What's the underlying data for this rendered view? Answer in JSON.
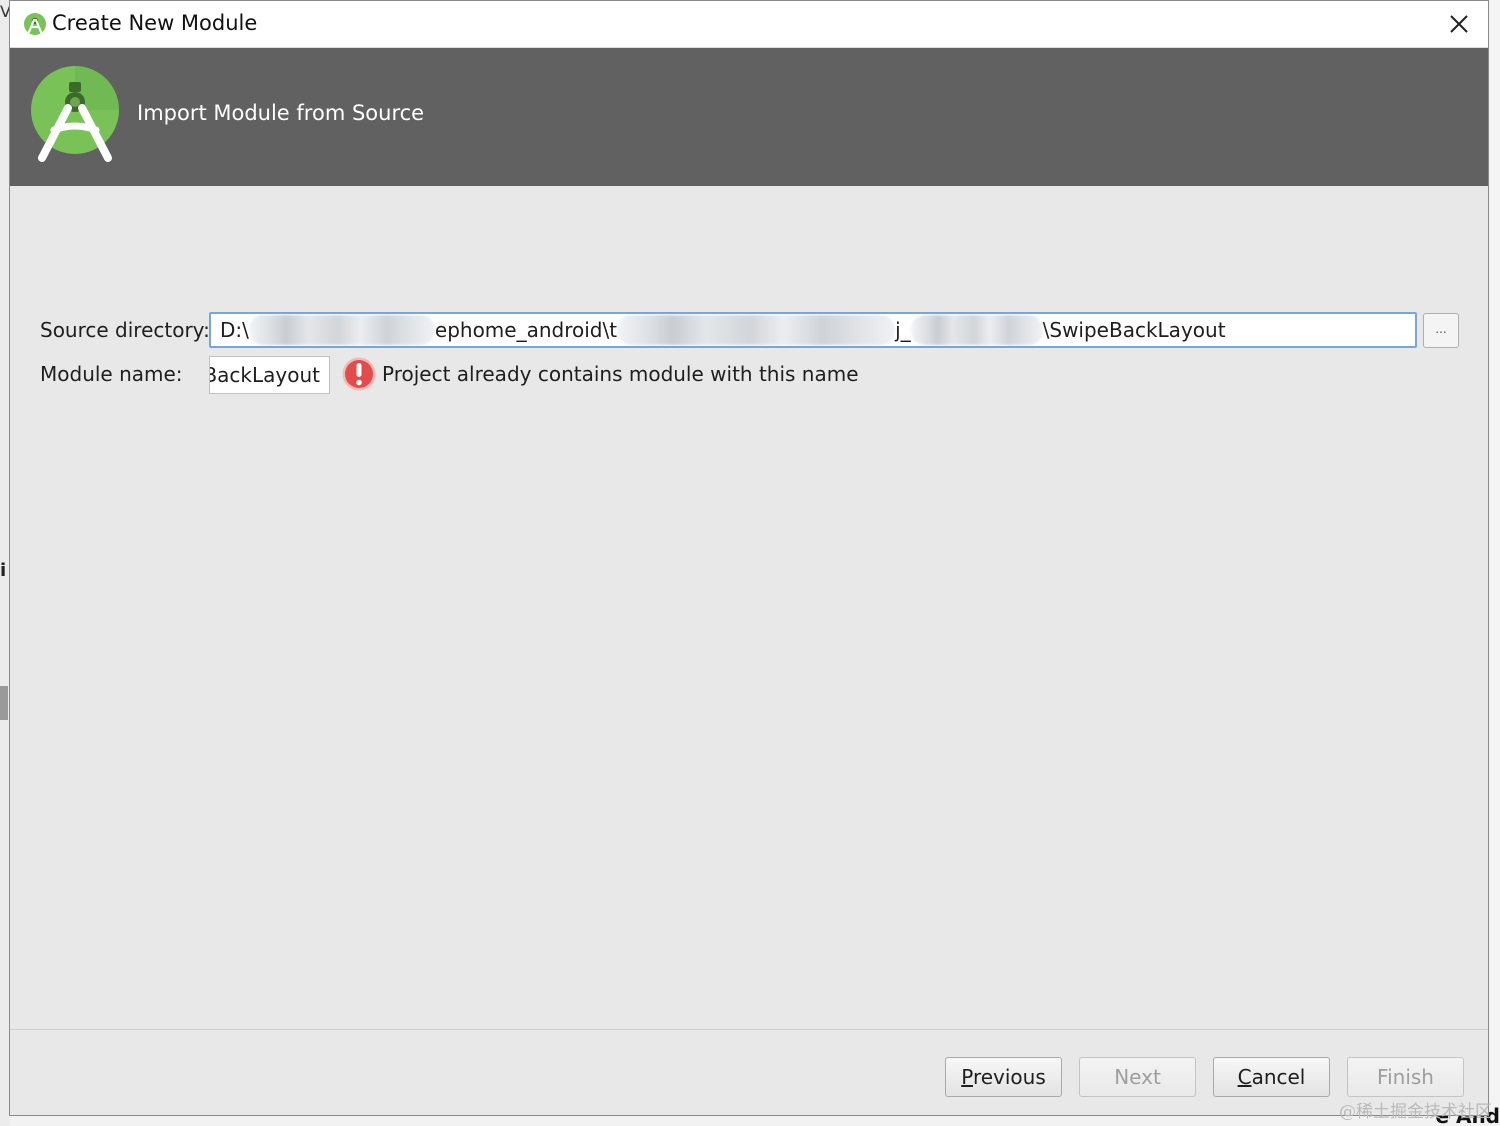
{
  "background": {
    "left_glyph_top": "V",
    "left_glyph_mid": "i",
    "bottom_right_glyphs": "e And"
  },
  "window": {
    "title": "Create New Module",
    "close_label": "×"
  },
  "banner": {
    "title": "Import Module from Source"
  },
  "form": {
    "source_label": "Source directory:",
    "source_value_parts": [
      "D:\\",
      "ephome_android\\t",
      "j_",
      "\\SwipeBackLayout"
    ],
    "browse_label": "...",
    "module_label": "Module name:",
    "module_value": "SwipeBackLayout",
    "error_message": "Project already contains module with this name"
  },
  "buttons": {
    "previous": {
      "label": "Previous",
      "enabled": true
    },
    "next": {
      "label": "Next",
      "enabled": false
    },
    "cancel": {
      "label": "Cancel",
      "enabled": true
    },
    "finish": {
      "label": "Finish",
      "enabled": false
    }
  },
  "watermark": "@稀土掘金技术社区",
  "colors": {
    "banner": "#616161",
    "dialog_bg": "#e8e8e8",
    "android_green": "#78c257",
    "error_red": "#e24c4b",
    "focus_border": "#7aa6d6"
  },
  "icons": {
    "title": "android-studio-icon",
    "banner": "android-studio-logo",
    "error": "error-icon",
    "close": "close-icon"
  }
}
